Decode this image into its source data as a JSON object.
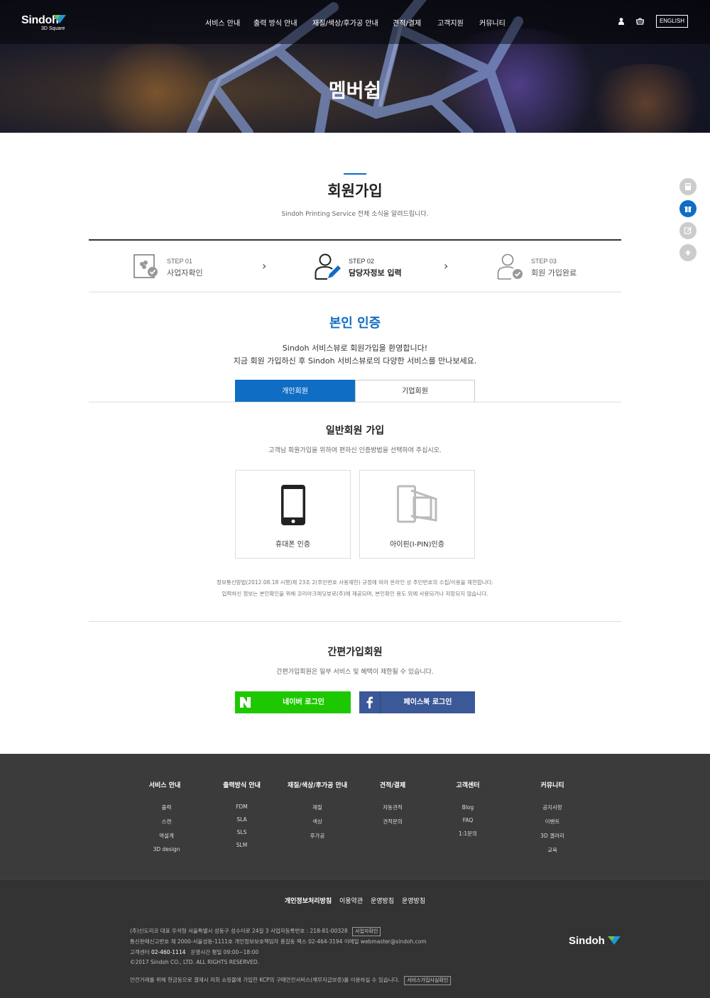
{
  "header": {
    "logo_text": "Sindoh",
    "logo_sub": "3D Square",
    "nav": [
      "서비스 안내",
      "출력 방식 안내",
      "재질/색상/후가공 안내",
      "견적/결제",
      "고객지원",
      "커뮤니티"
    ],
    "language_button": "ENGLISH",
    "user_icon": "user-icon",
    "cart_icon": "cart-icon"
  },
  "hero": {
    "title": "멤버쉽"
  },
  "floating": [
    "calculator-icon",
    "gift-icon",
    "edit-icon",
    "arrow-up-icon"
  ],
  "page": {
    "title": "회원가입",
    "subtitle": "Sindoh Printing Service 전체 소식을 알려드립니다."
  },
  "steps": [
    {
      "num": "STEP 01",
      "label": "사업자확인",
      "icon": "business-check-icon",
      "active": false
    },
    {
      "num": "STEP 02",
      "label": "담당자정보 입력",
      "icon": "user-edit-icon",
      "active": true
    },
    {
      "num": "STEP 03",
      "label": "회원 가입완료",
      "icon": "user-check-icon",
      "active": false
    }
  ],
  "verify": {
    "title": "본인 인증",
    "welcome_line1": "Sindoh 서비스뷰로 회원가입을 환영합니다!",
    "welcome_line2": "지금 회원 가입하신 후 Sindoh 서비스뷰로의 다양한 서비스를 만나보세요.",
    "tabs": [
      "개인회원",
      "기업회원"
    ],
    "active_tab": "개인회원"
  },
  "general": {
    "title": "일반회원 가입",
    "subtitle": "고객님 회원가입을 위하여 편하신 인증방법을 선택하여 주십시오.",
    "methods": [
      {
        "label": "휴대폰 인증",
        "icon": "mobile-phone-icon"
      },
      {
        "label": "아이핀(I-PIN)인증",
        "icon": "ipin-icon"
      }
    ],
    "notice1": "정보통신망법(2012.08.18 시행)제 23조 2(주민번호 사용제한) 규정에 따라 온라인 상 주민번호의 수집/이용을 제한합니다.",
    "notice2": "입력하신 정보는 본인확인을 위해 코리아크레딧뷰로(주)에 제공되며, 본인확인 용도 외에 사용되거나 저장되지 않습니다."
  },
  "easy": {
    "title": "간편가입회원",
    "subtitle": "간편가입회원은 일부 서비스 및 혜택이 제한될 수 있습니다.",
    "naver_label": "네이버 로그인",
    "facebook_label": "페이스북 로그인",
    "naver_color": "#1ec800",
    "facebook_color": "#3b5998"
  },
  "footer": {
    "columns": [
      {
        "title": "서비스 안내",
        "items": [
          "출력",
          "스캔",
          "역설계",
          "3D design"
        ]
      },
      {
        "title": "출력방식 안내",
        "items": [
          "FDM",
          "SLA",
          "SLS",
          "SLM"
        ]
      },
      {
        "title": "재질/색상/후가공 안내",
        "items": [
          "재질",
          "색상",
          "후가공"
        ]
      },
      {
        "title": "견적/결제",
        "items": [
          "자동견적",
          "견적문의"
        ]
      },
      {
        "title": "고객센터",
        "items": [
          "Blog",
          "FAQ",
          "1:1문의"
        ]
      },
      {
        "title": "커뮤니티",
        "items": [
          "공지사항",
          "이벤트",
          "3D 갤러리",
          "교육"
        ]
      }
    ],
    "links": [
      "개인정보처리방침",
      "이용약관",
      "운영방침",
      "운영방침"
    ],
    "info_line1": "(주)신도리코    대표 우석형    서울특별시 성동구 성수이로 24길 3    사업자등록번호 : 218-81-00328",
    "info_line1_button": "사업자확인",
    "info_line2": "통신판매신고번호 제 2000-서울성동-1111호    개인정보보호책임자 홍길동    팩스 02-464-3194    이메일 webmaster@sindoh.com",
    "info_line3_label": "고객센터",
    "info_line3_phone": "02-460-1114",
    "info_line3_rest": "운영시간 평일 09:00~18:00",
    "copyright": "©2017 Sindoh CO., LTD. ALL RIGHTS RESERVED.",
    "escrow": "안전거래를 위해 현금등으로 결제시 저희 쇼핑몰에 가입한 KCP의 구매안전서비스(채무지급보증)를 이용하실 수 있습니다.",
    "escrow_button": "서비스가입사실확인",
    "logo_text": "Sindoh"
  },
  "colors": {
    "accent": "#0f6dc3",
    "footer_bg": "#3b3b3b"
  }
}
